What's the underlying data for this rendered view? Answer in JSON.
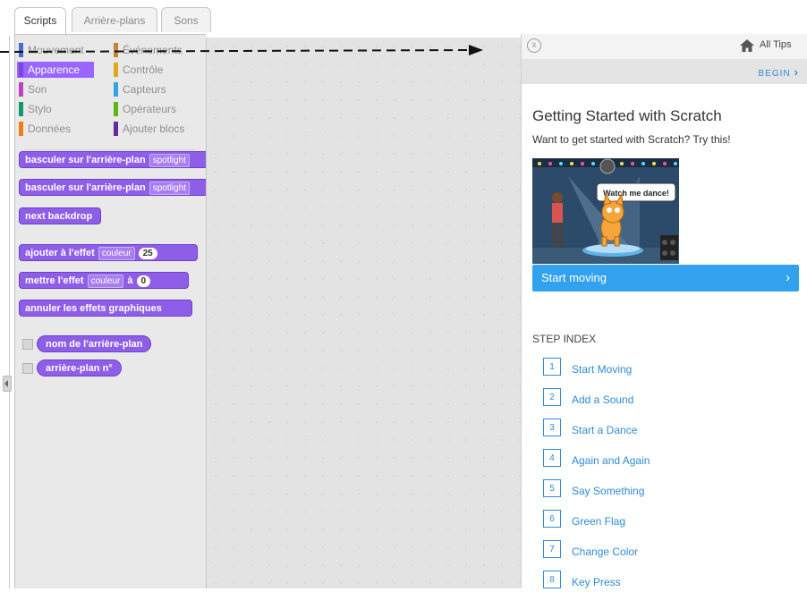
{
  "tabs": [
    {
      "label": "Scripts",
      "active": true
    },
    {
      "label": "Arrière-plans",
      "active": false
    },
    {
      "label": "Sons",
      "active": false
    }
  ],
  "categories": [
    {
      "label": "Mouvement",
      "color": "#4a6cd4"
    },
    {
      "label": "Événements",
      "color": "#c88330"
    },
    {
      "label": "Apparence",
      "color": "#8a55d7",
      "selected": true
    },
    {
      "label": "Contrôle",
      "color": "#e1a91a"
    },
    {
      "label": "Son",
      "color": "#bb42c3"
    },
    {
      "label": "Capteurs",
      "color": "#2ca5e2"
    },
    {
      "label": "Stylo",
      "color": "#0e9a6c"
    },
    {
      "label": "Opérateurs",
      "color": "#5cb712"
    },
    {
      "label": "Données",
      "color": "#ee7d16"
    },
    {
      "label": "Ajouter blocs",
      "color": "#632d99"
    }
  ],
  "blocks": {
    "switch_backdrop": {
      "text": "basculer sur l'arrière-plan",
      "dropdown": "spotlight"
    },
    "switch_backdrop_wait": {
      "text": "basculer sur l'arrière-plan",
      "dropdown": "spotlight"
    },
    "next_backdrop": {
      "text": "next backdrop"
    },
    "change_effect": {
      "text": "ajouter à l'effet",
      "dropdown": "couleur",
      "value": "25"
    },
    "set_effect": {
      "text": "mettre l'effet",
      "dropdown": "couleur",
      "sep": "à",
      "value": "0"
    },
    "clear_effects": {
      "text": "annuler les effets graphiques"
    },
    "backdrop_name": {
      "text": "nom de l'arrière-plan"
    },
    "backdrop_number": {
      "text": "arrière-plan n°"
    }
  },
  "tips": {
    "close_label": "x",
    "all_tips": "All Tips",
    "begin": "BEGIN",
    "title": "Getting Started with Scratch",
    "subtitle": "Want to get started with Scratch? Try this!",
    "illustration_text": "Watch me dance!",
    "start_button": "Start moving",
    "step_index_title": "STEP INDEX",
    "steps": [
      {
        "num": "1",
        "label": "Start Moving"
      },
      {
        "num": "2",
        "label": "Add a Sound"
      },
      {
        "num": "3",
        "label": "Start a Dance"
      },
      {
        "num": "4",
        "label": "Again and Again"
      },
      {
        "num": "5",
        "label": "Say Something"
      },
      {
        "num": "6",
        "label": "Green Flag"
      },
      {
        "num": "7",
        "label": "Change Color"
      },
      {
        "num": "8",
        "label": "Key Press"
      }
    ]
  },
  "colors": {
    "looks": "#8f5ee8",
    "link": "#2f8bd6",
    "start_button": "#32a2ef"
  }
}
